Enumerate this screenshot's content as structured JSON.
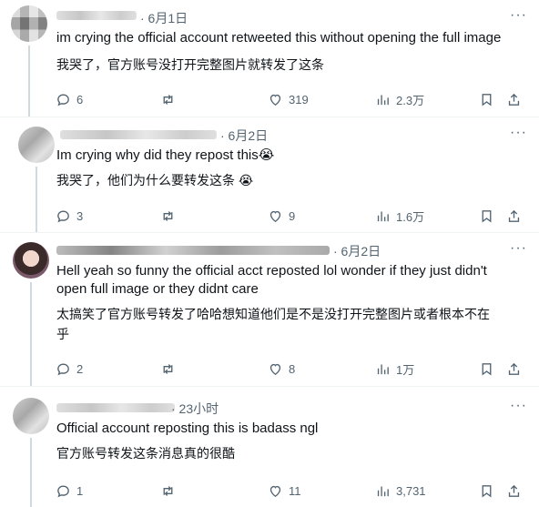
{
  "tweets": [
    {
      "date": "· 6月1日",
      "text": "im crying the official account retweeted this without opening the full image",
      "translation": "我哭了，官方账号没打开完整图片就转发了这条",
      "replies": "6",
      "retweets": "",
      "likes": "319",
      "views": "2.3万"
    },
    {
      "date": "· 6月2日",
      "text": "Im crying why did they repost this😭",
      "translation": "我哭了，他们为什么要转发这条 😭",
      "replies": "3",
      "retweets": "",
      "likes": "9",
      "views": "1.6万"
    },
    {
      "date": "· 6月2日",
      "text_line1": "Hell yeah so funny the official acct reposted lol wonder if they just didn't",
      "text_line2": "open full image or they didnt care",
      "translation_line1": "太搞笑了官方账号转发了哈哈想知道他们是不是没打开完整图片或者根本不在",
      "translation_line2": "乎",
      "replies": "2",
      "retweets": "",
      "likes": "8",
      "views": "1万"
    },
    {
      "date": "· 23小时",
      "text": "Official account reposting this is badass ngl",
      "translation": "官方账号转发这条消息真的很酷",
      "replies": "1",
      "retweets": "",
      "likes": "11",
      "views": "3,731"
    }
  ],
  "more_label": "···",
  "icons": [
    "reply-icon",
    "retweet-icon",
    "like-icon",
    "views-icon",
    "bookmark-icon",
    "share-icon"
  ]
}
